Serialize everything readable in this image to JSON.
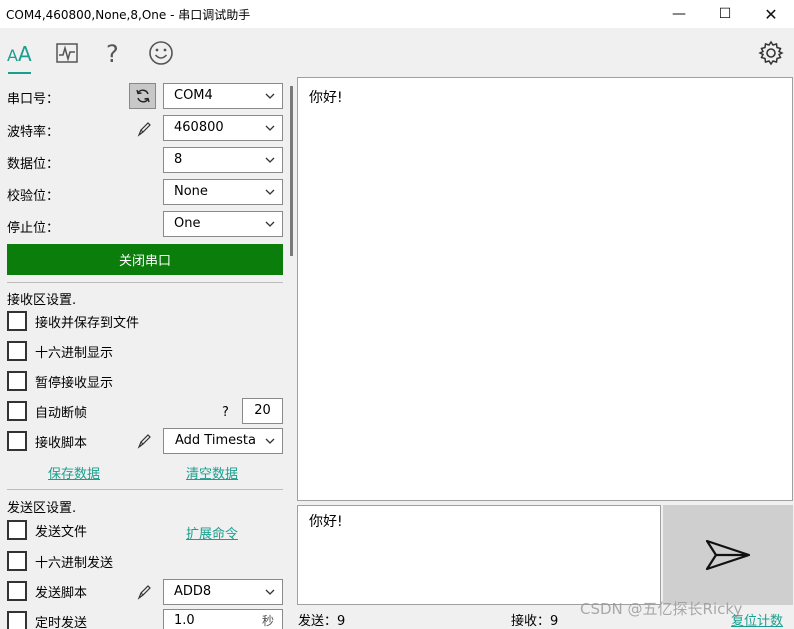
{
  "window": {
    "title": "COM4,460800,None,8,One - 串口调试助手",
    "minimize": "—",
    "maximize": "☐",
    "close": "✕"
  },
  "toolbar": {
    "icons": [
      "font-icon",
      "chart-icon",
      "help-icon",
      "smiley-icon",
      "settings-icon"
    ],
    "accent": "#1a9f8e"
  },
  "settings": {
    "port_label": "串口号：",
    "port_value": "COM4",
    "baud_label": "波特率：",
    "baud_value": "460800",
    "databits_label": "数据位：",
    "databits_value": "8",
    "parity_label": "校验位：",
    "parity_value": "None",
    "stopbits_label": "停止位：",
    "stopbits_value": "One",
    "close_port": "关闭串口",
    "close_port_color": "#0a7d0a"
  },
  "receive": {
    "section_title": "接收区设置.",
    "save_to_file": "接收并保存到文件",
    "hex_display": "十六进制显示",
    "pause_display": "暂停接收显示",
    "auto_frame": "自动断帧",
    "auto_frame_q": "?",
    "auto_frame_value": "20",
    "script_label": "接收脚本",
    "script_value": "Add Timesta",
    "save_data": "保存数据",
    "clear_data": "清空数据",
    "content": "你好!"
  },
  "send": {
    "section_title": "发送区设置.",
    "send_file": "发送文件",
    "extend_cmd": "扩展命令",
    "hex_send": "十六进制发送",
    "script_label": "发送脚本",
    "script_value": "ADD8",
    "timed_send": "定时发送",
    "timed_value": "1.0",
    "timed_unit": "秒",
    "content": "你好!"
  },
  "status": {
    "sent": "发送：9",
    "received": "接收：9",
    "reset": "复位计数"
  },
  "watermark": "CSDN @五亿探长Ricky"
}
